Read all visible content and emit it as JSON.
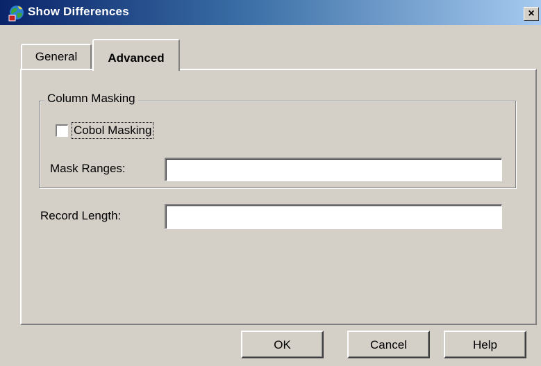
{
  "window": {
    "title": "Show Differences",
    "icon": "globe-app-icon",
    "close_glyph": "×"
  },
  "tabs": [
    {
      "label": "General",
      "selected": false
    },
    {
      "label": "Advanced",
      "selected": true
    }
  ],
  "column_masking": {
    "legend": "Column Masking",
    "cobol_masking": {
      "label": "Cobol Masking",
      "checked": false
    },
    "mask_ranges": {
      "label": "Mask Ranges:",
      "value": ""
    }
  },
  "record_length": {
    "label": "Record Length:",
    "value": ""
  },
  "buttons": {
    "ok": "OK",
    "cancel": "Cancel",
    "help": "Help"
  }
}
